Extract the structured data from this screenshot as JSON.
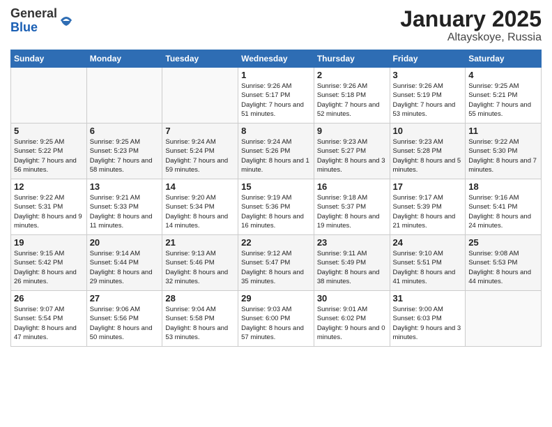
{
  "header": {
    "logo_general": "General",
    "logo_blue": "Blue",
    "month_title": "January 2025",
    "location": "Altayskoye, Russia"
  },
  "days_of_week": [
    "Sunday",
    "Monday",
    "Tuesday",
    "Wednesday",
    "Thursday",
    "Friday",
    "Saturday"
  ],
  "weeks": [
    [
      {
        "day": "",
        "info": ""
      },
      {
        "day": "",
        "info": ""
      },
      {
        "day": "",
        "info": ""
      },
      {
        "day": "1",
        "info": "Sunrise: 9:26 AM\nSunset: 5:17 PM\nDaylight: 7 hours and 51 minutes."
      },
      {
        "day": "2",
        "info": "Sunrise: 9:26 AM\nSunset: 5:18 PM\nDaylight: 7 hours and 52 minutes."
      },
      {
        "day": "3",
        "info": "Sunrise: 9:26 AM\nSunset: 5:19 PM\nDaylight: 7 hours and 53 minutes."
      },
      {
        "day": "4",
        "info": "Sunrise: 9:25 AM\nSunset: 5:21 PM\nDaylight: 7 hours and 55 minutes."
      }
    ],
    [
      {
        "day": "5",
        "info": "Sunrise: 9:25 AM\nSunset: 5:22 PM\nDaylight: 7 hours and 56 minutes."
      },
      {
        "day": "6",
        "info": "Sunrise: 9:25 AM\nSunset: 5:23 PM\nDaylight: 7 hours and 58 minutes."
      },
      {
        "day": "7",
        "info": "Sunrise: 9:24 AM\nSunset: 5:24 PM\nDaylight: 7 hours and 59 minutes."
      },
      {
        "day": "8",
        "info": "Sunrise: 9:24 AM\nSunset: 5:26 PM\nDaylight: 8 hours and 1 minute."
      },
      {
        "day": "9",
        "info": "Sunrise: 9:23 AM\nSunset: 5:27 PM\nDaylight: 8 hours and 3 minutes."
      },
      {
        "day": "10",
        "info": "Sunrise: 9:23 AM\nSunset: 5:28 PM\nDaylight: 8 hours and 5 minutes."
      },
      {
        "day": "11",
        "info": "Sunrise: 9:22 AM\nSunset: 5:30 PM\nDaylight: 8 hours and 7 minutes."
      }
    ],
    [
      {
        "day": "12",
        "info": "Sunrise: 9:22 AM\nSunset: 5:31 PM\nDaylight: 8 hours and 9 minutes."
      },
      {
        "day": "13",
        "info": "Sunrise: 9:21 AM\nSunset: 5:33 PM\nDaylight: 8 hours and 11 minutes."
      },
      {
        "day": "14",
        "info": "Sunrise: 9:20 AM\nSunset: 5:34 PM\nDaylight: 8 hours and 14 minutes."
      },
      {
        "day": "15",
        "info": "Sunrise: 9:19 AM\nSunset: 5:36 PM\nDaylight: 8 hours and 16 minutes."
      },
      {
        "day": "16",
        "info": "Sunrise: 9:18 AM\nSunset: 5:37 PM\nDaylight: 8 hours and 19 minutes."
      },
      {
        "day": "17",
        "info": "Sunrise: 9:17 AM\nSunset: 5:39 PM\nDaylight: 8 hours and 21 minutes."
      },
      {
        "day": "18",
        "info": "Sunrise: 9:16 AM\nSunset: 5:41 PM\nDaylight: 8 hours and 24 minutes."
      }
    ],
    [
      {
        "day": "19",
        "info": "Sunrise: 9:15 AM\nSunset: 5:42 PM\nDaylight: 8 hours and 26 minutes."
      },
      {
        "day": "20",
        "info": "Sunrise: 9:14 AM\nSunset: 5:44 PM\nDaylight: 8 hours and 29 minutes."
      },
      {
        "day": "21",
        "info": "Sunrise: 9:13 AM\nSunset: 5:46 PM\nDaylight: 8 hours and 32 minutes."
      },
      {
        "day": "22",
        "info": "Sunrise: 9:12 AM\nSunset: 5:47 PM\nDaylight: 8 hours and 35 minutes."
      },
      {
        "day": "23",
        "info": "Sunrise: 9:11 AM\nSunset: 5:49 PM\nDaylight: 8 hours and 38 minutes."
      },
      {
        "day": "24",
        "info": "Sunrise: 9:10 AM\nSunset: 5:51 PM\nDaylight: 8 hours and 41 minutes."
      },
      {
        "day": "25",
        "info": "Sunrise: 9:08 AM\nSunset: 5:53 PM\nDaylight: 8 hours and 44 minutes."
      }
    ],
    [
      {
        "day": "26",
        "info": "Sunrise: 9:07 AM\nSunset: 5:54 PM\nDaylight: 8 hours and 47 minutes."
      },
      {
        "day": "27",
        "info": "Sunrise: 9:06 AM\nSunset: 5:56 PM\nDaylight: 8 hours and 50 minutes."
      },
      {
        "day": "28",
        "info": "Sunrise: 9:04 AM\nSunset: 5:58 PM\nDaylight: 8 hours and 53 minutes."
      },
      {
        "day": "29",
        "info": "Sunrise: 9:03 AM\nSunset: 6:00 PM\nDaylight: 8 hours and 57 minutes."
      },
      {
        "day": "30",
        "info": "Sunrise: 9:01 AM\nSunset: 6:02 PM\nDaylight: 9 hours and 0 minutes."
      },
      {
        "day": "31",
        "info": "Sunrise: 9:00 AM\nSunset: 6:03 PM\nDaylight: 9 hours and 3 minutes."
      },
      {
        "day": "",
        "info": ""
      }
    ]
  ]
}
